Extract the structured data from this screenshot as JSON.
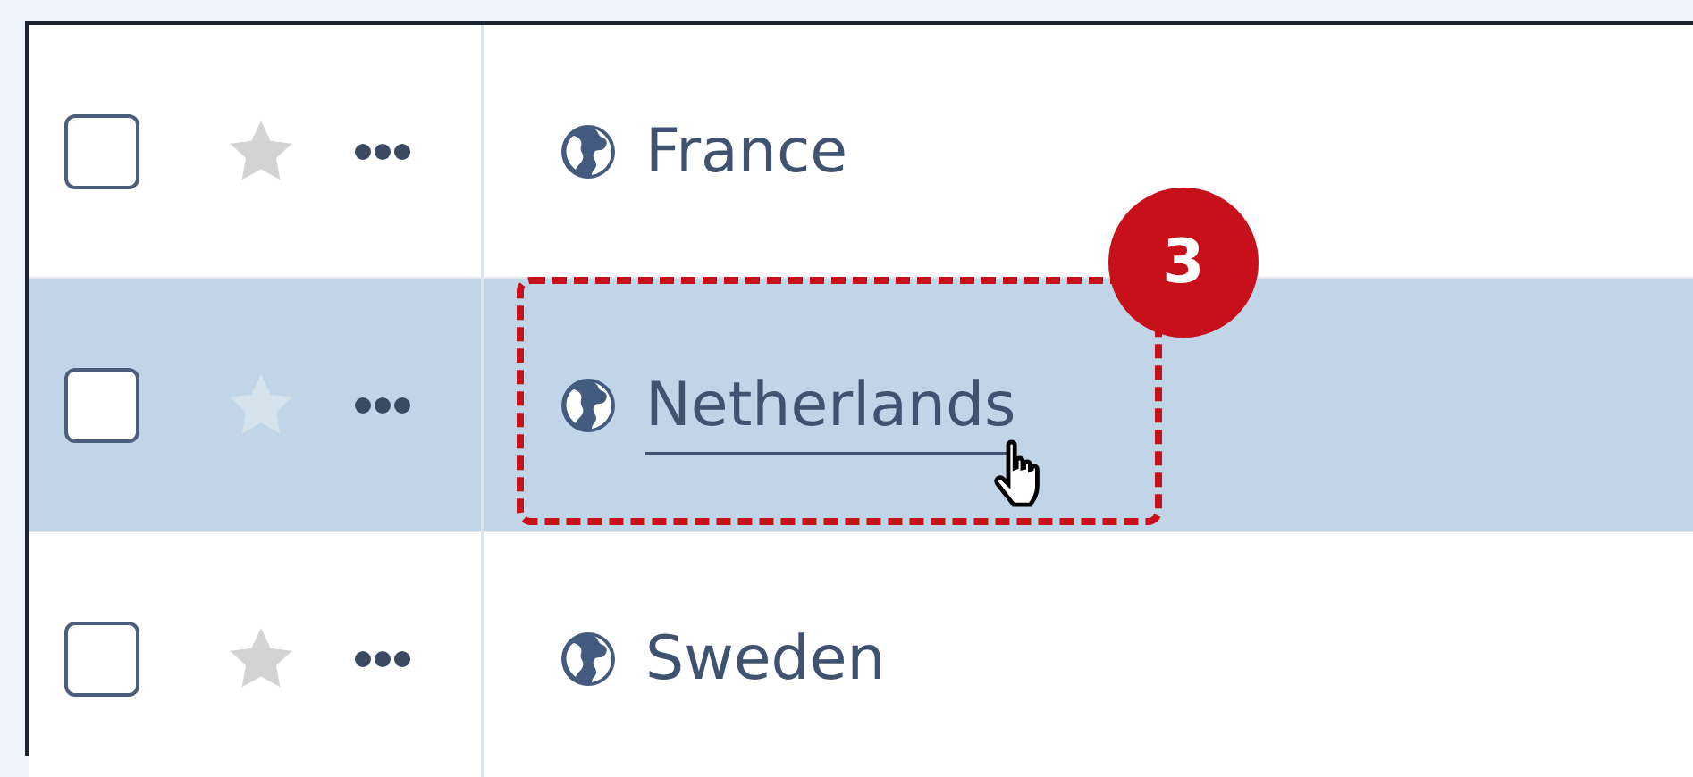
{
  "rows": [
    {
      "label": "France",
      "selected": false,
      "checked": false,
      "starred": false,
      "hovered": false
    },
    {
      "label": "Netherlands",
      "selected": true,
      "checked": false,
      "starred": false,
      "hovered": true
    },
    {
      "label": "Sweden",
      "selected": false,
      "checked": false,
      "starred": false,
      "hovered": false
    }
  ],
  "annotation": {
    "badge": "3"
  }
}
